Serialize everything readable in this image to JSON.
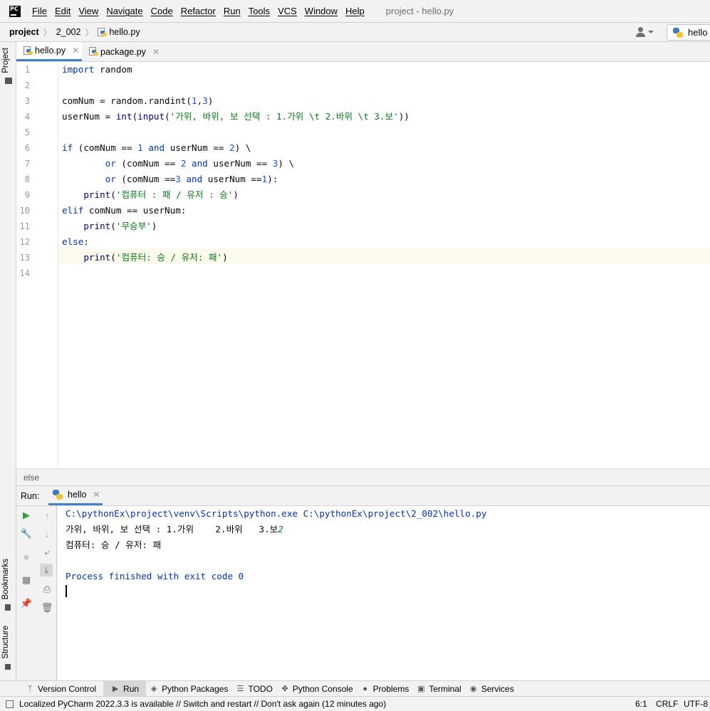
{
  "app": {
    "logo": "PC",
    "window_title": "project - hello.py"
  },
  "menu": [
    "File",
    "Edit",
    "View",
    "Navigate",
    "Code",
    "Refactor",
    "Run",
    "Tools",
    "VCS",
    "Window",
    "Help"
  ],
  "breadcrumb": {
    "project": "project",
    "folder": "2_002",
    "file": "hello.py"
  },
  "run_config": {
    "label": "hello"
  },
  "left_stripe": {
    "project": "Project",
    "bookmarks": "Bookmarks",
    "structure": "Structure"
  },
  "tabs": [
    {
      "label": "hello.py",
      "active": true
    },
    {
      "label": "package.py",
      "active": false
    }
  ],
  "line_numbers": [
    "1",
    "2",
    "3",
    "4",
    "5",
    "6",
    "7",
    "8",
    "9",
    "10",
    "11",
    "12",
    "13",
    "14"
  ],
  "code": {
    "l1": {
      "kw": "import",
      "rest": " random"
    },
    "l3": {
      "a": "comNum = random.randint(",
      "n1": "1",
      "c": ",",
      "n2": "3",
      "z": ")"
    },
    "l4": {
      "a": "userNum = ",
      "f1": "int",
      "b": "(",
      "f2": "input",
      "c": "(",
      "s": "'가위, 바위, 보 선택 : 1.가위 \\t 2.바위 \\t 3.보'",
      "z": "))"
    },
    "l6": {
      "kw": "if",
      "a": " (comNum == ",
      "n1": "1",
      "kw2": " and",
      "b": " userNum == ",
      "n2": "2",
      "z": ") \\"
    },
    "l7": {
      "indent": "        ",
      "kw": "or",
      "a": " (comNum == ",
      "n1": "2",
      "kw2": " and",
      "b": " userNum == ",
      "n2": "3",
      "z": ") \\"
    },
    "l8": {
      "indent": "        ",
      "kw": "or",
      "a": " (comNum ==",
      "n1": "3",
      "kw2": " and",
      "b": " userNum ==",
      "n2": "1",
      "z": "):"
    },
    "l9": {
      "indent": "    ",
      "f": "print",
      "a": "(",
      "s": "'컴퓨터 : 패 / 유저 : 승'",
      "z": ")"
    },
    "l10": {
      "kw": "elif",
      "rest": " comNum == userNum:"
    },
    "l11": {
      "indent": "    ",
      "f": "print",
      "a": "(",
      "s": "'무승부'",
      "z": ")"
    },
    "l12": {
      "kw": "else",
      "rest": ":"
    },
    "l13": {
      "indent": "    ",
      "f": "print",
      "a": "(",
      "s": "'컴퓨터: 승 / 유저: 패'",
      "z": ")"
    }
  },
  "code_crumb": "else",
  "run_panel": {
    "label": "Run:",
    "tab": "hello",
    "console": {
      "cmd": "C:\\pythonEx\\project\\venv\\Scripts\\python.exe C:\\pythonEx\\project\\2_002\\hello.py",
      "prompt": "가위, 바위, 보 선택 : 1.가위    2.바위   3.보",
      "input": "2",
      "result": "컴퓨터: 승 / 유저: 패",
      "exit": "Process finished with exit code 0"
    }
  },
  "bottom_tools": [
    "Version Control",
    "Run",
    "Python Packages",
    "TODO",
    "Python Console",
    "Problems",
    "Terminal",
    "Services"
  ],
  "status": {
    "message": "Localized PyCharm 2022.3.3 is available // Switch and restart // Don't ask again (12 minutes ago)",
    "position": "6:1",
    "line_sep": "CRLF",
    "encoding": "UTF-8"
  },
  "colors": {
    "accent": "#4083c9",
    "keyword": "#0033b3",
    "number": "#1750eb",
    "string": "#067d17",
    "builtin": "#000080"
  }
}
